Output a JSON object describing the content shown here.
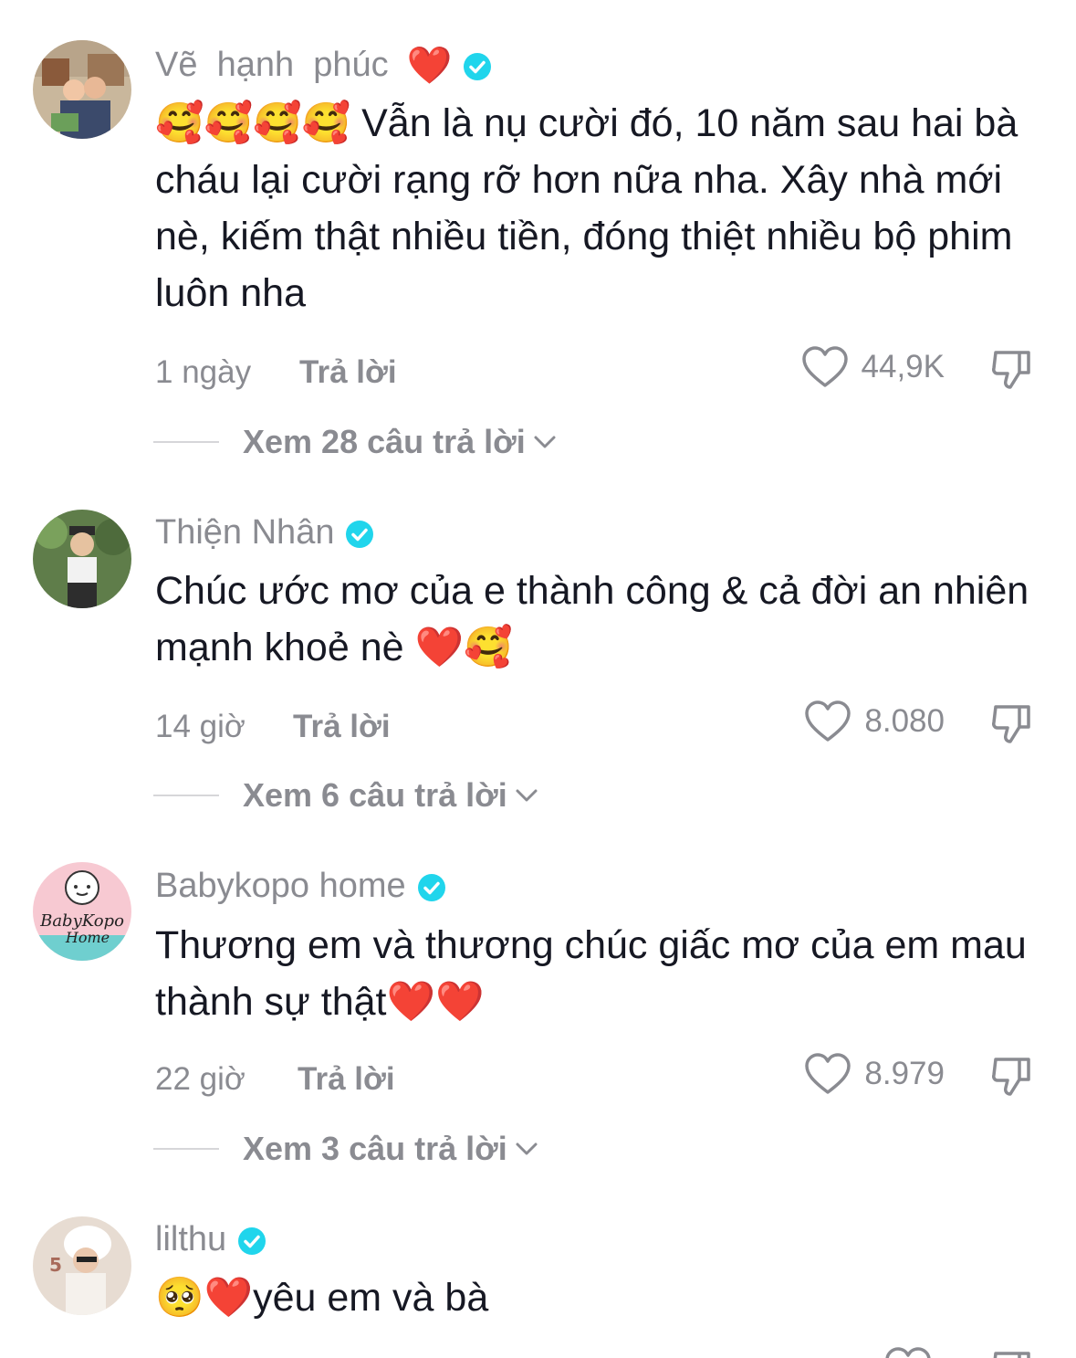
{
  "comments": [
    {
      "username": "Vẽ  hạnh  phúc",
      "username_emoji": "❤️",
      "text": "🥰🥰🥰🥰 Vẫn là nụ cười đó, 10 năm sau hai bà cháu lại cười rạng rỡ hơn nữa nha. Xây nhà mới nè, kiếm thật nhiều tiền, đóng thiệt nhiều bộ phim luôn nha",
      "time": "1 ngày",
      "reply_label": "Trả lời",
      "likes": "44,9K",
      "view_replies": "Xem 28 câu trả lời"
    },
    {
      "username": "Thiện Nhân",
      "text": "Chúc ước mơ của e thành công & cả đời an nhiên mạnh khoẻ nè ❤️🥰",
      "time": "14 giờ",
      "reply_label": "Trả lời",
      "likes": "8.080",
      "view_replies": "Xem 6 câu trả lời"
    },
    {
      "username": "Babykopo home",
      "text": "Thương em và thương chúc giấc mơ của em mau thành sự thật❤️❤️",
      "time": "22 giờ",
      "reply_label": "Trả lời",
      "likes": "8.979",
      "view_replies": "Xem 3 câu trả lời"
    },
    {
      "username": "lilthu",
      "text": "🥺❤️yêu em và bà"
    }
  ],
  "icons": {
    "verified": "verified-badge-icon",
    "like": "heart-outline-icon",
    "dislike": "thumbs-down-icon",
    "chevron": "chevron-down-icon"
  },
  "colors": {
    "verified": "#20D5EC",
    "secondary_text": "#8A8B91",
    "primary_text": "#161823"
  }
}
